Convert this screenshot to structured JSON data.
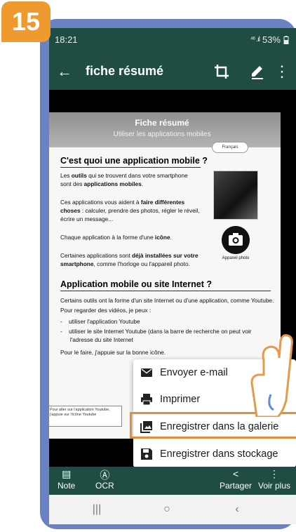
{
  "step_badge": "15",
  "status_bar": {
    "time": "18:21",
    "signal": "⁴⁶ .ıl",
    "battery": "53%"
  },
  "app_bar": {
    "title": "fiche résumé"
  },
  "document": {
    "header_title": "Fiche résumé",
    "header_subtitle": "Utiliser les applications mobiles",
    "lang_chip": "Français",
    "h1": "C'est quoi une application mobile ?",
    "p1a": "Les ",
    "p1b": "outils",
    "p1c": " qui se trouvent dans votre smartphone",
    "p1d": "sont des ",
    "p1e": "applications mobiles",
    "p1f": ".",
    "p2a": "Ces applications vous aident à ",
    "p2b": "faire différentes",
    "p2c": "choses",
    "p2d": " : calculer, prendre des photos, régler le réveil,",
    "p2e": "écrire un message...",
    "p3a": "Chaque application à la forme d'une ",
    "p3b": "icône",
    "p3c": ".",
    "p4a": "Certaines applications sont ",
    "p4b": "déjà installées sur votre",
    "p4c": "smartphone",
    "p4d": ", comme l'horloge ou l'appareil photo.",
    "camera_caption": "Appareil photo",
    "h2": "Application mobile ou site Internet ?",
    "p5": "Certains outils ont la forme d'un site Internet ou d'une application, comme Youtube.",
    "p6": "Pour regarder des vidéos, je peux :",
    "li1": "utiliser l'application Youtube",
    "li2": "utiliser le site Internet Youtube (dans la barre de recherche on peut voir",
    "li2b": "l'adresse du site Internet",
    "p7": "Pour le faire, j'appuie sur la bonne icône.",
    "side_note": "Pour aller sur l'application Youtube, j'appuie sur l'icône Youtube"
  },
  "menu": {
    "items": [
      {
        "label": "Envoyer e-mail",
        "icon": "email-icon"
      },
      {
        "label": "Imprimer",
        "icon": "print-icon"
      },
      {
        "label": "Enregistrer dans la galerie",
        "icon": "gallery-icon"
      },
      {
        "label": "Enregistrer dans stockage",
        "icon": "save-icon"
      }
    ],
    "highlight_color": "#e38c3c"
  },
  "bottom_bar": {
    "note": "Note",
    "ocr": "OCR",
    "share": "Partager",
    "more": "Voir plus"
  },
  "colors": {
    "app_bar": "#1f4d43",
    "phone_frame": "#6a82c4",
    "badge": "#ef9a2e"
  }
}
